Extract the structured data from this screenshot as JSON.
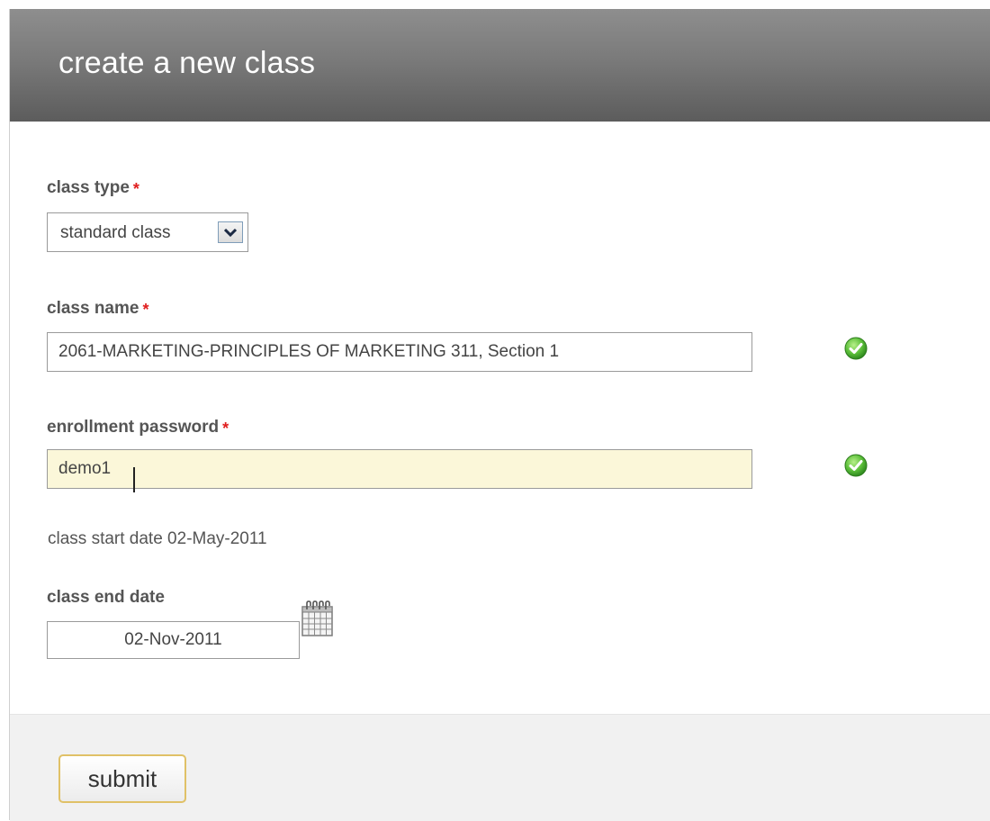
{
  "header": {
    "title": "create a new class"
  },
  "form": {
    "class_type": {
      "label": "class type",
      "required_mark": "*",
      "selected": "standard class"
    },
    "class_name": {
      "label": "class name",
      "required_mark": "*",
      "value": "2061-MARKETING-PRINCIPLES OF MARKETING 311, Section 1",
      "valid": true
    },
    "enrollment_password": {
      "label": "enrollment password",
      "required_mark": "*",
      "value": "demo1",
      "valid": true
    },
    "start_date_text": "class start date 02-May-2011",
    "end_date": {
      "label": "class end date",
      "value": "02-Nov-2011"
    }
  },
  "footer": {
    "submit_label": "submit"
  },
  "icons": {
    "valid": "check-circle-icon",
    "calendar": "calendar-icon",
    "dropdown": "chevron-down-icon"
  },
  "colors": {
    "header_bg": "#7a7a7a",
    "required": "#e01e1e",
    "valid_green": "#43a32e",
    "focused_input_bg": "#fbf7d9",
    "button_border": "#e0c167"
  }
}
